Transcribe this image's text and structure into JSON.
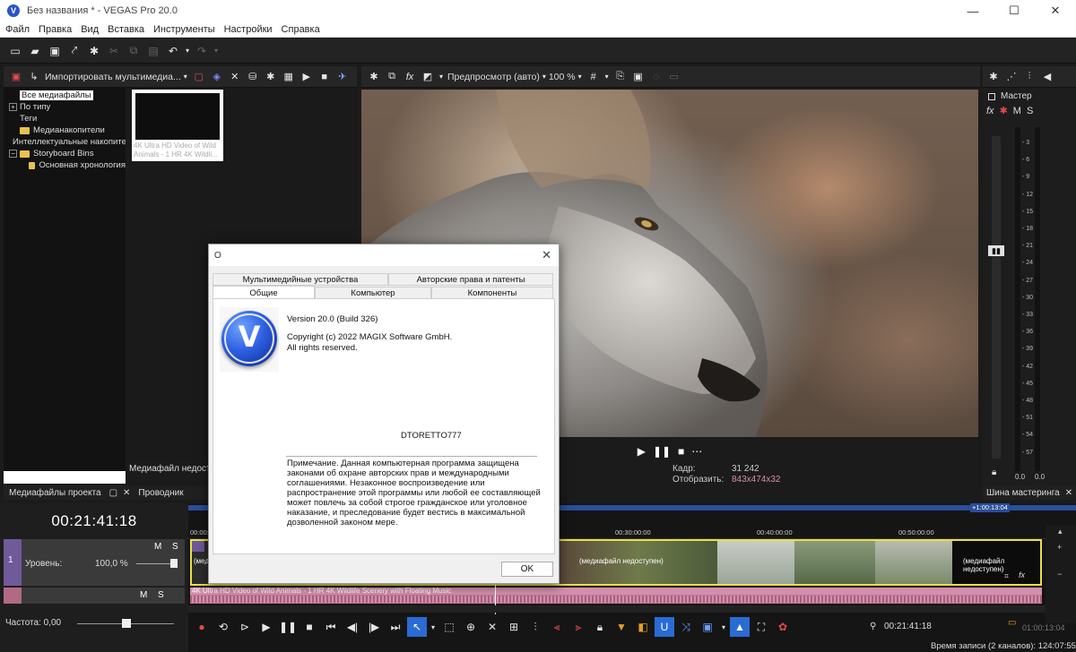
{
  "window": {
    "title": "Без названия * - VEGAS Pro 20.0",
    "logo_letter": "V"
  },
  "menu": [
    "Файл",
    "Правка",
    "Вид",
    "Вставка",
    "Инструменты",
    "Настройки",
    "Справка"
  ],
  "media_panel": {
    "import_label": "Импортировать мультимедиа...",
    "tree": [
      {
        "label": "Все медиафайлы",
        "selected": true,
        "indent": 0,
        "expander": "",
        "folder": false
      },
      {
        "label": "По типу",
        "selected": false,
        "indent": 0,
        "expander": "+",
        "folder": false
      },
      {
        "label": "Теги",
        "selected": false,
        "indent": 0,
        "expander": "",
        "folder": false
      },
      {
        "label": "Медианакопители",
        "selected": false,
        "indent": 0,
        "expander": "",
        "folder": true
      },
      {
        "label": "Интеллектуальные накопители",
        "selected": false,
        "indent": 0,
        "expander": "",
        "folder": true
      },
      {
        "label": "Storyboard Bins",
        "selected": false,
        "indent": 0,
        "expander": "−",
        "folder": true
      },
      {
        "label": "Основная хронология",
        "selected": false,
        "indent": 1,
        "expander": "",
        "folder": true
      }
    ],
    "thumb_caption": "4K Ultra HD Video of Wild Animals - 1 HR 4K Wildli...",
    "status": "Медиафайл недоступен",
    "tabs": [
      "Медиафайлы проекта",
      "Проводник"
    ]
  },
  "preview": {
    "mode_label": "Предпросмотр (авто)",
    "zoom_label": "100 %",
    "frame_label": "Кадр:",
    "frame_value": "31 242",
    "display_label": "Отобразить:",
    "display_value": "843x474x32"
  },
  "master": {
    "label": "Мастер",
    "m": "M",
    "s": "S",
    "scale": [
      "3",
      "6",
      "9",
      "12",
      "15",
      "18",
      "21",
      "24",
      "27",
      "30",
      "33",
      "36",
      "39",
      "42",
      "45",
      "48",
      "51",
      "54",
      "57"
    ],
    "left_value": "0.0",
    "right_value": "0.0",
    "tab": "Шина мастеринга"
  },
  "timeline": {
    "timecode": "00:21:41:18",
    "ruler": [
      "00:00:00",
      "00:30:00:00",
      "00:40:00:00",
      "00:50:00:00"
    ],
    "ruler_end": "+1:00:13:04",
    "video_track_number": "1",
    "video_level_label": "Уровень:",
    "video_level_value": "100,0 %",
    "m": "M",
    "s": "S",
    "clip_offline_left": "(медиа",
    "clip_offline_mid": "(медиафайл недоступен)",
    "clip_offline_right": "(медиафайл недоступен)",
    "audio_clip_title": "4K Ultra HD Video of Wild Animals - 1 HR 4K Wildlife Scenery with Floating Music",
    "rate_label": "Частота: 0,00",
    "transport_timecode": "00:21:41:18",
    "end_timecode": "01:00:13:04",
    "record_time": "Время записи (2 каналов): 124:07:55"
  },
  "dialog": {
    "title": "О",
    "tabs_back": [
      "Мультимедийные устройства",
      "Авторские права и патенты"
    ],
    "tabs_front": [
      "Общие",
      "Компьютер",
      "Компоненты"
    ],
    "version": "Version 20.0 (Build 326)",
    "copyright": "Copyright (c) 2022 MAGIX Software GmbH.",
    "rights": "All rights reserved.",
    "user": "DTORETTO777",
    "notice_lines": [
      "Примечание. Данная компьютерная программа защищена",
      "законами об охране авторских прав и международными",
      "соглашениями. Незаконное воспроизведение или",
      "распространение этой программы или любой ее составляющей",
      "может повлечь за собой строгое гражданское или уголовное",
      "наказание, и преследование будет вестись в максимальной",
      "дозволенной законом мере."
    ],
    "ok": "OK",
    "logo_letter": "V"
  }
}
